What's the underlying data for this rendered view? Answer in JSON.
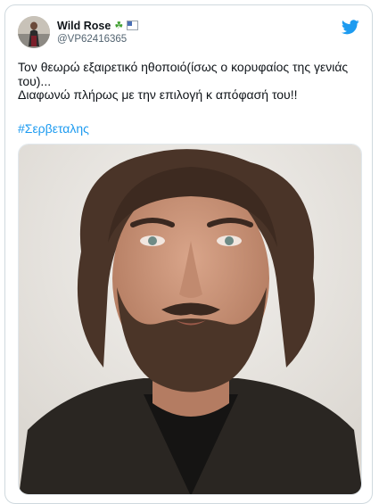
{
  "user": {
    "display_name": "Wild Rose",
    "badge_icons": [
      "shamrock-icon",
      "flag-icon"
    ],
    "handle": "@VP62416365"
  },
  "tweet": {
    "line1": "Τον θεωρώ εξαιρετικό ηθοποιό(ίσως ο κορυφαίος της γενιάς του)...",
    "line2": "Διαφωνώ πλήρως με την επιλογή κ απόφασή του!!",
    "hashtag": "#Σερβεταλης"
  },
  "colors": {
    "accent": "#1d9bf0",
    "text": "#0f1419",
    "muted": "#536471",
    "border": "#cfd9de"
  },
  "icons": {
    "brand": "twitter-bird-icon"
  }
}
